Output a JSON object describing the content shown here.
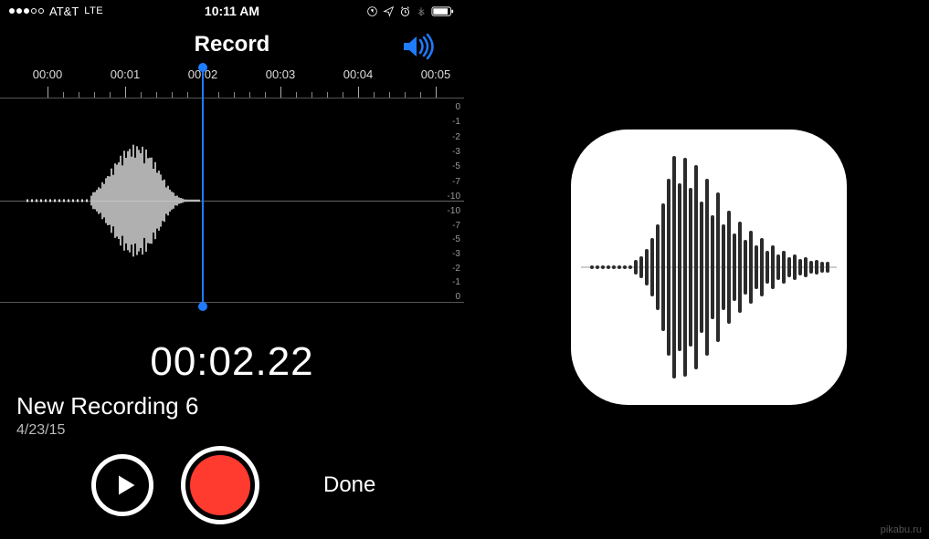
{
  "status_bar": {
    "carrier": "AT&T",
    "network": "LTE",
    "time": "10:11 AM",
    "signal_dots_filled": 3,
    "signal_dots_total": 5,
    "icons": [
      "rotation-lock",
      "location",
      "alarm",
      "bluetooth",
      "battery"
    ]
  },
  "header": {
    "title": "Record"
  },
  "timeline": {
    "ticks": [
      "00:00",
      "00:01",
      "00:02",
      "00:03",
      "00:04",
      "00:05"
    ],
    "db_scale_top": [
      "0",
      "-1",
      "-2",
      "-3",
      "-5",
      "-7",
      "-10"
    ],
    "db_scale_bottom": [
      "-10",
      "-7",
      "-5",
      "-3",
      "-2",
      "-1",
      "0"
    ],
    "playhead_time": "00:02"
  },
  "elapsed": "00:02.22",
  "recording": {
    "name": "New Recording 6",
    "date": "4/23/15"
  },
  "controls": {
    "done_label": "Done"
  },
  "colors": {
    "accent_blue": "#1f7cff",
    "record_red": "#ff3b2f"
  },
  "watermark": "pikabu.ru"
}
